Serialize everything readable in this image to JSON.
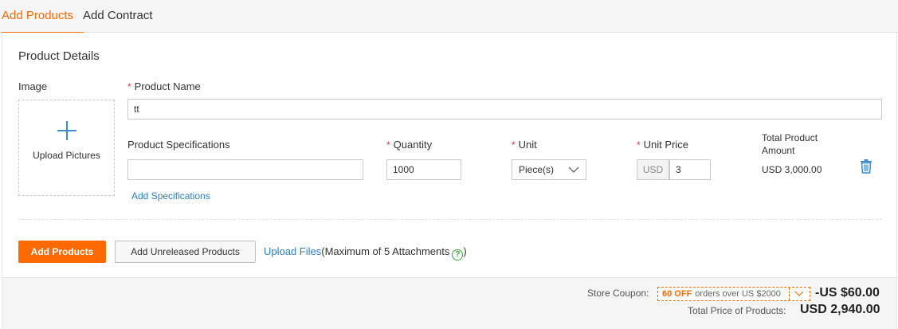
{
  "tabs": [
    {
      "label": "Add Products",
      "active": true
    },
    {
      "label": "Add Contract",
      "active": false
    }
  ],
  "product_details": {
    "title": "Product Details",
    "image_label": "Image",
    "upload_label": "Upload Pictures",
    "required_mark": "*",
    "product_name_label": "Product Name",
    "product_name_value": "tt",
    "specs_label": "Product Specifications",
    "specs_value": "",
    "add_specs_link": "Add Specifications",
    "quantity_label": "Quantity",
    "quantity_value": "1000",
    "unit_label": "Unit",
    "unit_value": "Piece(s)",
    "unit_price_label": "Unit Price",
    "currency": "USD",
    "unit_price_value": "3",
    "total_label_line1": "Total Product",
    "total_label_line2": "Amount",
    "total_value": "USD 3,000.00"
  },
  "actions": {
    "add_products": "Add Products",
    "add_unreleased": "Add Unreleased Products",
    "upload_link": "Upload Files",
    "upload_note": "(Maximum of 5 Attachments",
    "help_glyph": "?",
    "upload_note_close": ")"
  },
  "footer": {
    "coupon_label": "Store Coupon:",
    "coupon_amount": "60 OFF",
    "coupon_desc": "orders over US $2000",
    "discount": "-US $60.00",
    "total_label": "Total Price of Products:",
    "total_value": "USD 2,940.00"
  },
  "colors": {
    "accent": "#ff6a00",
    "link": "#2a7fc4",
    "required": "#e4393c"
  },
  "icons": [
    "plus-icon",
    "chevron-down-icon",
    "trash-icon",
    "help-icon"
  ]
}
